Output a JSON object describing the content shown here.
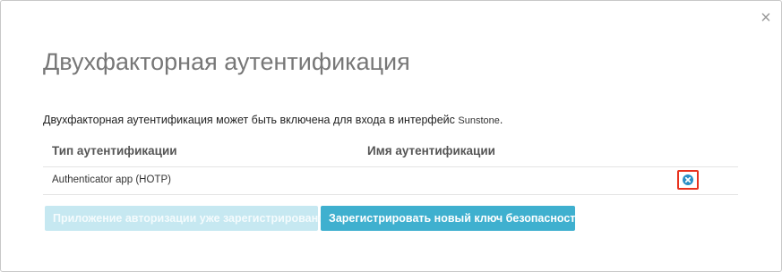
{
  "dialog": {
    "title": "Двухфакторная аутентификация",
    "close_symbol": "×",
    "description_text": "Двухфакторная аутентификация может быть включена для входа в интерфейс ",
    "description_brand": "Sunstone",
    "description_end": "."
  },
  "table": {
    "headers": {
      "auth_type": "Тип аутентификации",
      "auth_name": "Имя аутентификации"
    },
    "rows": [
      {
        "type": "Authenticator app (HOTP)",
        "name": "",
        "action_icon": "remove-circle-icon"
      }
    ]
  },
  "buttons": {
    "app_registered": "Приложение авторизации уже зарегистрировано",
    "register_key": "Зарегистрировать новый ключ безопасности"
  },
  "colors": {
    "accent": "#3fb0cf",
    "accent_disabled": "#c6e8f1",
    "highlight": "#e8321e",
    "icon_blue": "#2b8fc6"
  }
}
